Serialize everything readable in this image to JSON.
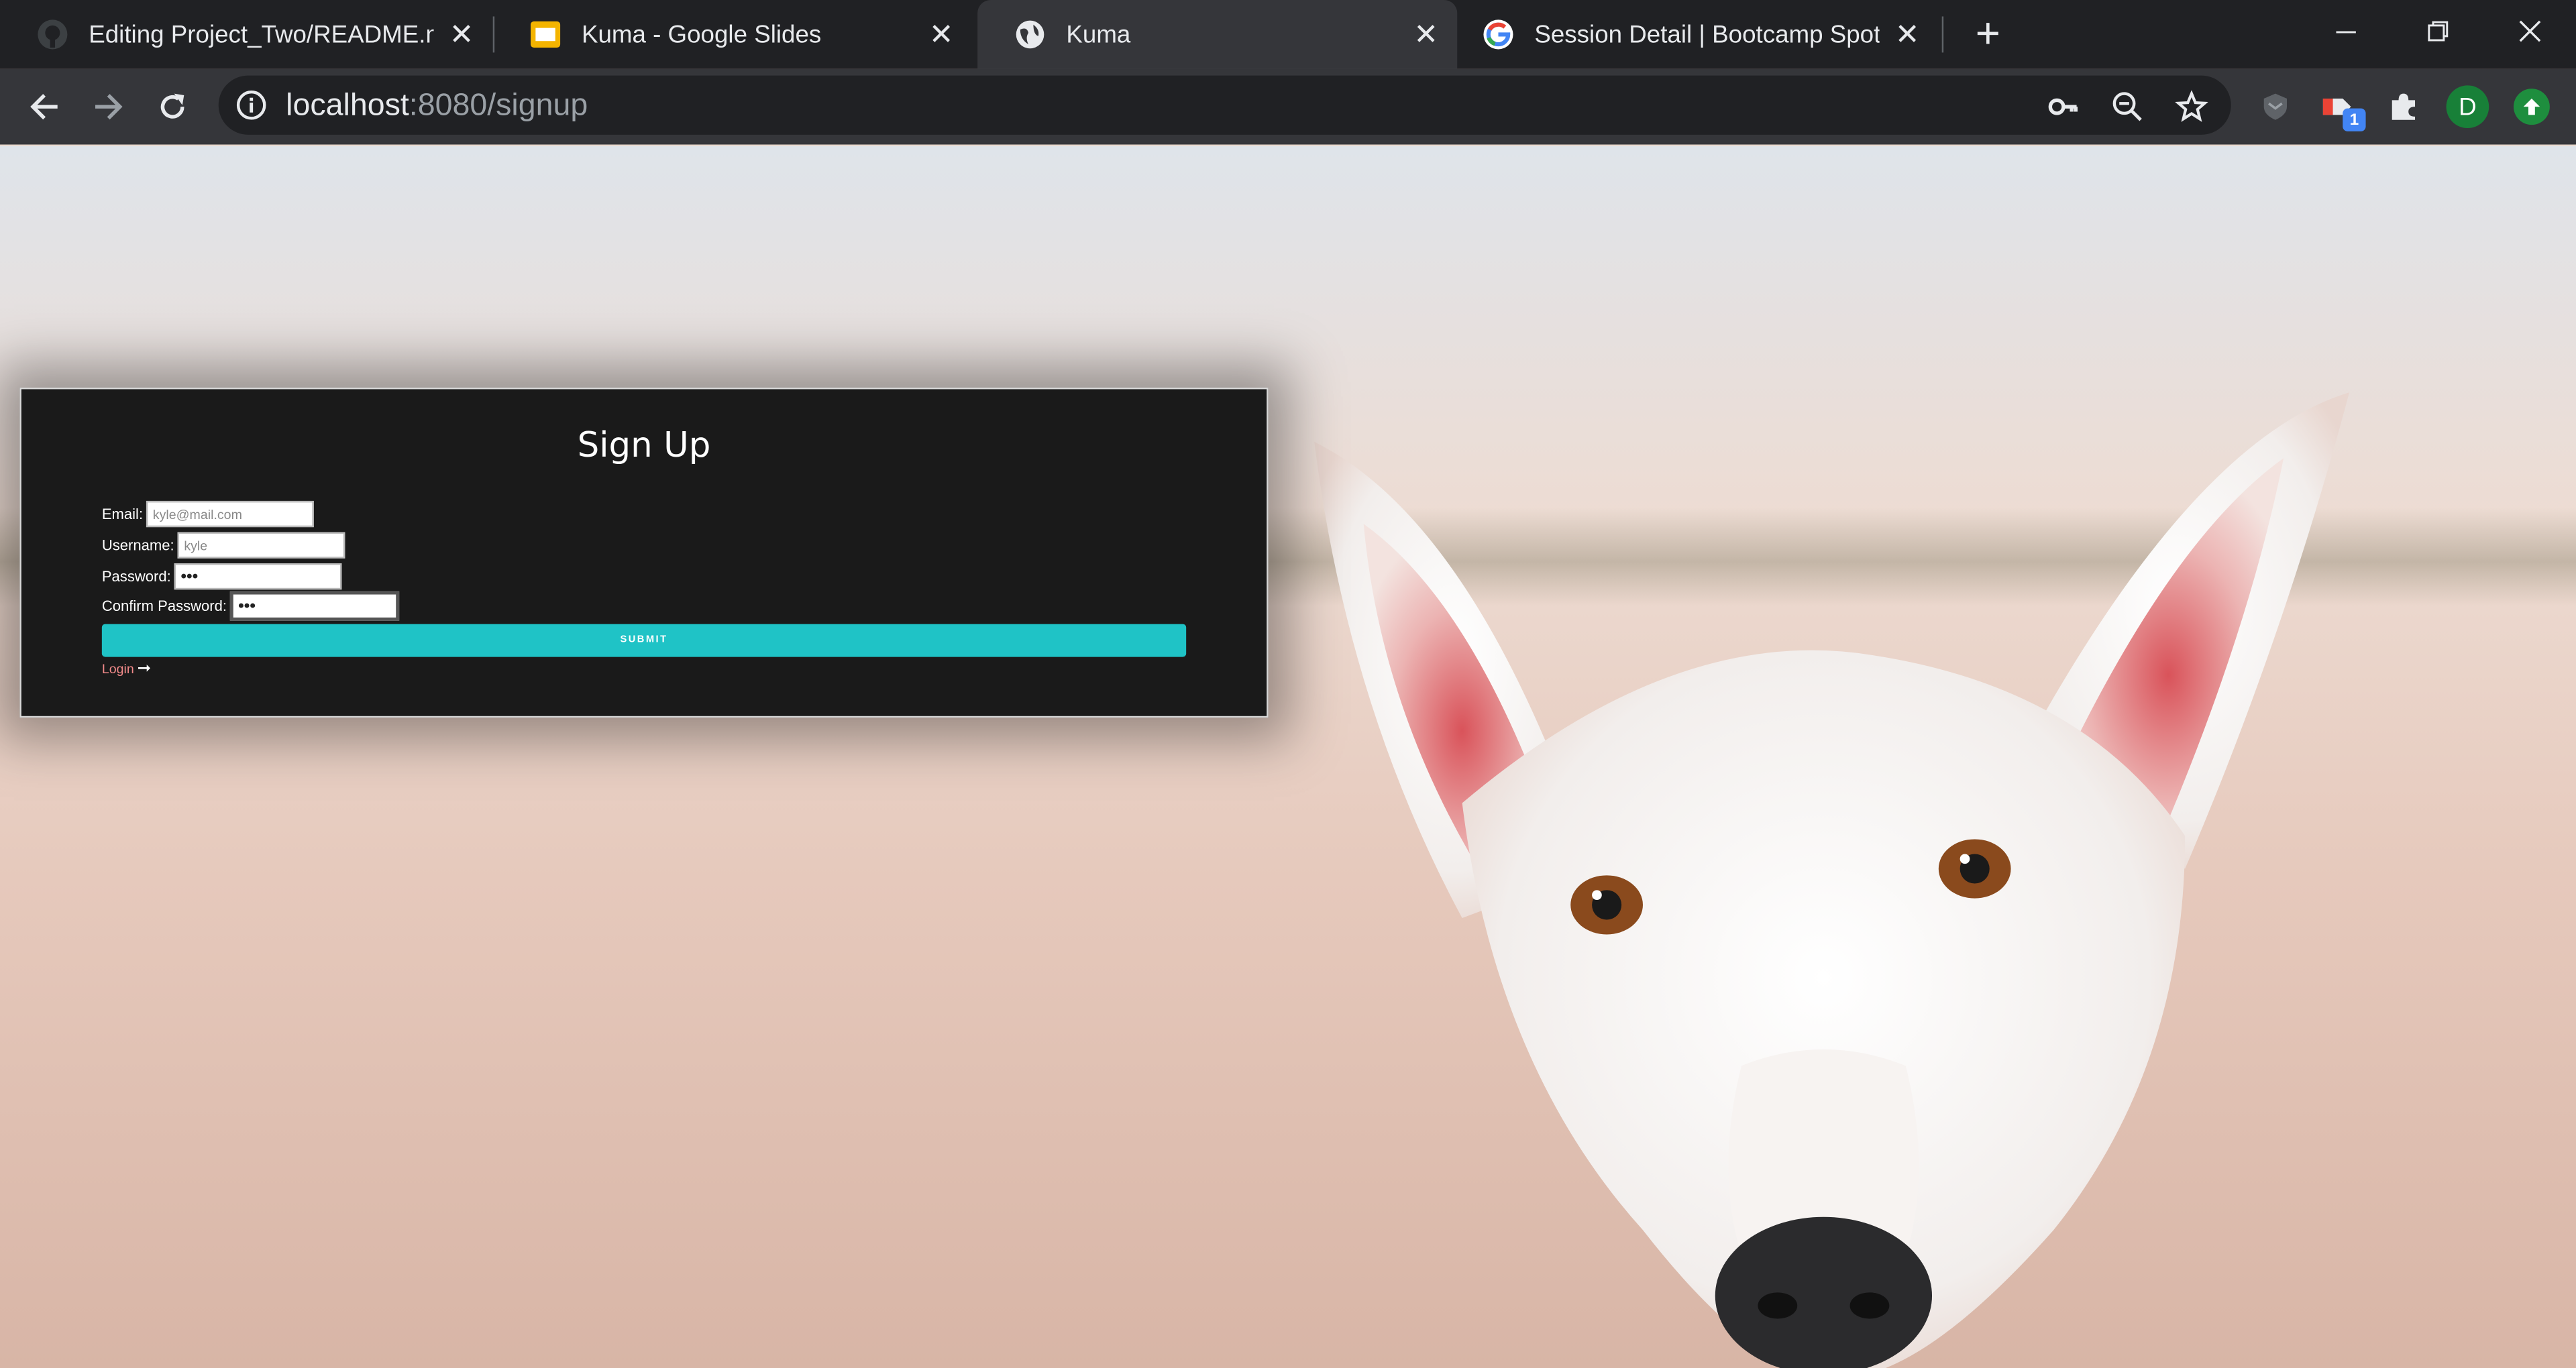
{
  "browser": {
    "tabs": [
      {
        "title": "Editing Project_Two/README.md",
        "icon": "github-icon"
      },
      {
        "title": "Kuma - Google Slides",
        "icon": "google-slides-icon"
      },
      {
        "title": "Kuma",
        "icon": "globe-icon",
        "active": true
      },
      {
        "title": "Session Detail | Bootcamp Spot",
        "icon": "google-icon"
      }
    ],
    "url_host": "localhost",
    "url_rest": ":8080/signup",
    "profile_initial": "D",
    "extension_badge": "1"
  },
  "form": {
    "title": "Sign Up",
    "email_label": "Email:",
    "email_placeholder": "kyle@mail.com",
    "username_label": "Username:",
    "username_value": "kyle",
    "password_label": "Password:",
    "password_value": "•••",
    "confirm_label": "Confirm Password:",
    "confirm_value": "•••",
    "submit_label": "SUBMIT",
    "login_link": "Login",
    "login_arrow": "➞"
  },
  "colors": {
    "submit": "#1fc3c6",
    "login_link": "#f28a8a",
    "panel": "#1a1a1a"
  }
}
